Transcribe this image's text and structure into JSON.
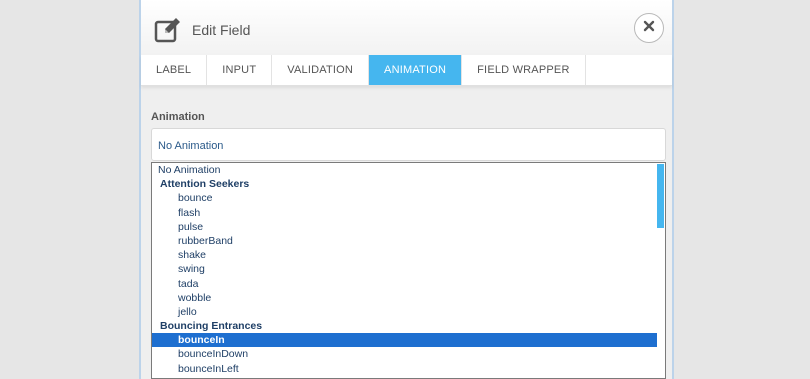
{
  "header": {
    "title": "Edit Field",
    "edit_icon": "edit-icon",
    "close_icon": "close-icon"
  },
  "tabs": [
    {
      "label": "LABEL",
      "active": false
    },
    {
      "label": "INPUT",
      "active": false
    },
    {
      "label": "VALIDATION",
      "active": false
    },
    {
      "label": "ANIMATION",
      "active": true
    },
    {
      "label": "FIELD WRAPPER",
      "active": false
    }
  ],
  "animation": {
    "label": "Animation",
    "selected_value": "No Animation"
  },
  "dropdown": {
    "top_option": "No Animation",
    "groups": [
      {
        "label": "Attention Seekers",
        "options": [
          "bounce",
          "flash",
          "pulse",
          "rubberBand",
          "shake",
          "swing",
          "tada",
          "wobble",
          "jello"
        ]
      },
      {
        "label": "Bouncing Entrances",
        "options": [
          "bounceIn",
          "bounceInDown",
          "bounceInLeft"
        ]
      }
    ],
    "highlighted": "bounceIn"
  },
  "colors": {
    "accent": "#45b6ef",
    "highlight": "#1e6fd0",
    "option_text": "#1f3f66"
  }
}
